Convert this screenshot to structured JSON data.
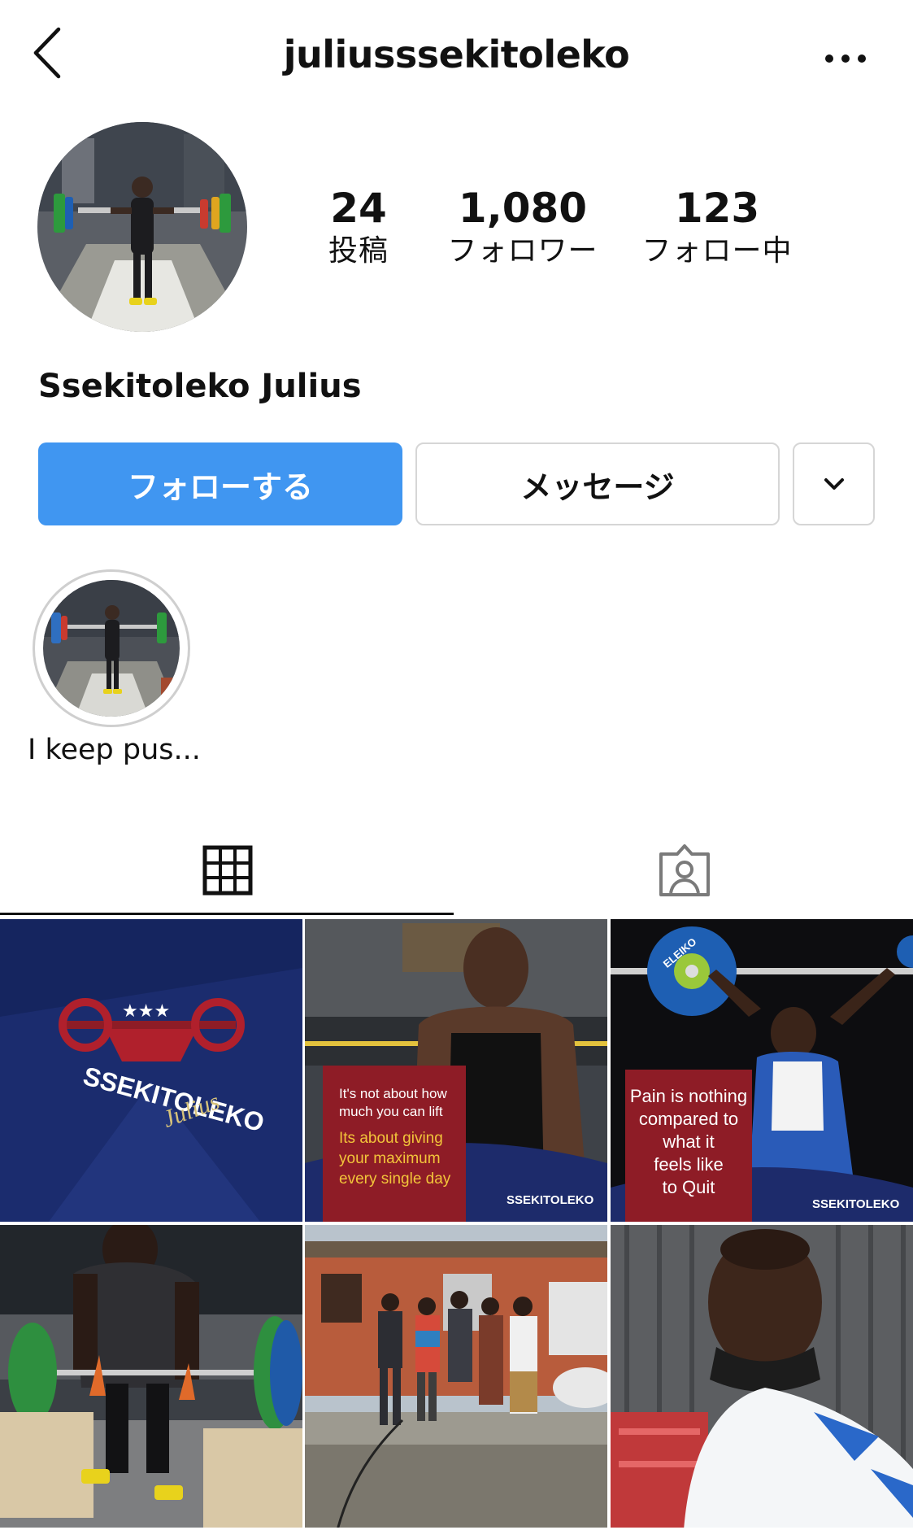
{
  "header": {
    "username": "juliusssekitoleko",
    "back_icon": "chevron-left-icon",
    "more_icon": "more-horizontal-icon"
  },
  "profile": {
    "display_name": "Ssekitoleko Julius",
    "stats": [
      {
        "value": "24",
        "label": "投稿"
      },
      {
        "value": "1,080",
        "label": "フォロワー"
      },
      {
        "value": "123",
        "label": "フォロー中"
      }
    ]
  },
  "actions": {
    "follow_label": "フォローする",
    "message_label": "メッセージ",
    "more_icon": "chevron-down-icon"
  },
  "highlights": [
    {
      "label": "I keep  pus..."
    }
  ],
  "tabs": {
    "grid_icon": "grid-icon",
    "tagged_icon": "tagged-person-icon"
  },
  "posts": {
    "p1": {
      "brand": "SSEKITOLEKO",
      "script": "Julius"
    },
    "p2": {
      "line1": "It's not about how",
      "line2": "much you can lift",
      "line3": "Its about giving",
      "line4": "your maximum",
      "line5": "every single day",
      "brand": "SSEKITOLEKO"
    },
    "p3": {
      "line1": "Pain is nothing",
      "line2": "compared to",
      "line3": "what it",
      "line4": "feels like",
      "line5": "to Quit",
      "brand": "SSEKITOLEKO",
      "plate": "ELEIKO"
    }
  },
  "colors": {
    "accent": "#4096f1",
    "border": "#d6d6d6",
    "navy": "#1a2a6b",
    "maroon": "#8e1c26"
  }
}
